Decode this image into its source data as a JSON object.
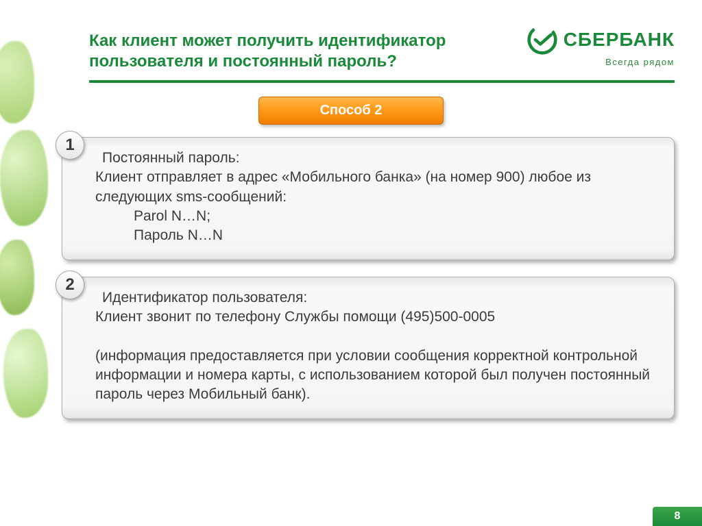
{
  "title": "Как клиент может получить идентификатор пользователя и постоянный пароль?",
  "logo": {
    "bank_name": "СБЕРБАНК",
    "tagline": "Всегда рядом"
  },
  "method_label": "Способ 2",
  "card1": {
    "number": "1",
    "heading": "Постоянный пароль:",
    "line1": "Клиент отправляет в адрес «Мобильного банка» (на номер 900) любое из следующих sms-сообщений:",
    "code1": "Parol N…N;",
    "code2": "Пароль N…N"
  },
  "card2": {
    "number": "2",
    "heading": "Идентификатор пользователя:",
    "line1": "Клиент звонит по телефону Службы помощи  (495)500-0005",
    "line2": "(информация предоставляется при условии сообщения корректной контрольной информации и номера карты, с использованием которой был получен постоянный пароль через Мобильный банк)."
  },
  "page_number": "8"
}
